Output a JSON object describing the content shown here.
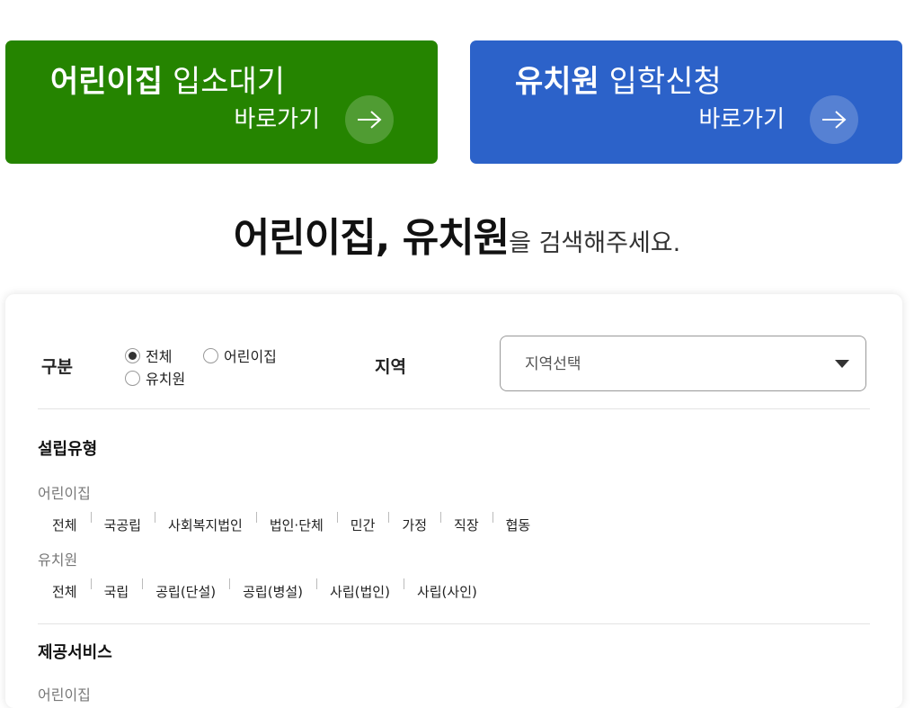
{
  "banners": {
    "daycare": {
      "title_bold": "어린이집",
      "title_light": "입소대기",
      "link_label": "바로가기",
      "color": "#258400"
    },
    "kindergarten": {
      "title_bold": "유치원",
      "title_light": "입학신청",
      "link_label": "바로가기",
      "color": "#2c62c9"
    }
  },
  "headline": {
    "strong": "어린이집, 유치원",
    "rest": "을 검색해주세요."
  },
  "search": {
    "category_label": "구분",
    "category_options": [
      {
        "label": "전체",
        "selected": true
      },
      {
        "label": "어린이집",
        "selected": false
      },
      {
        "label": "유치원",
        "selected": false
      }
    ],
    "region_label": "지역",
    "region_placeholder": "지역선택"
  },
  "establishment": {
    "title": "설립유형",
    "daycare": {
      "label": "어린이집",
      "options": [
        "전체",
        "국공립",
        "사회복지법인",
        "법인·단체",
        "민간",
        "가정",
        "직장",
        "협동"
      ]
    },
    "kindergarten": {
      "label": "유치원",
      "options": [
        "전체",
        "국립",
        "공립(단설)",
        "공립(병설)",
        "사립(법인)",
        "사립(사인)"
      ]
    }
  },
  "services": {
    "title": "제공서비스",
    "daycare": {
      "label": "어린이집"
    }
  }
}
